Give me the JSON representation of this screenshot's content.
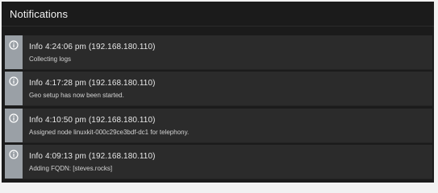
{
  "panel": {
    "title": "Notifications"
  },
  "notifications": [
    {
      "level": "Info",
      "time": "4:24:06 pm",
      "source": "(192.168.180.110)",
      "headline": "Info 4:24:06 pm (192.168.180.110)",
      "message": "Collecting logs"
    },
    {
      "level": "Info",
      "time": "4:17:28 pm",
      "source": "(192.168.180.110)",
      "headline": "Info 4:17:28 pm (192.168.180.110)",
      "message": "Geo setup has now been started."
    },
    {
      "level": "Info",
      "time": "4:10:50 pm",
      "source": "(192.168.180.110)",
      "headline": "Info 4:10:50 pm (192.168.180.110)",
      "message": "Assigned node linuxkit-000c29ce3bdf-dc1 for telephony."
    },
    {
      "level": "Info",
      "time": "4:09:13 pm",
      "source": "(192.168.180.110)",
      "headline": "Info 4:09:13 pm (192.168.180.110)",
      "message": "Adding FQDN: [steves.rocks]"
    }
  ],
  "icons": {
    "info": "info-icon"
  },
  "colors": {
    "panel_background": "#1b1b1b",
    "item_background": "#2b2b2b",
    "info_stripe": "#9aa0a6",
    "text_primary": "#e8e8e8"
  }
}
